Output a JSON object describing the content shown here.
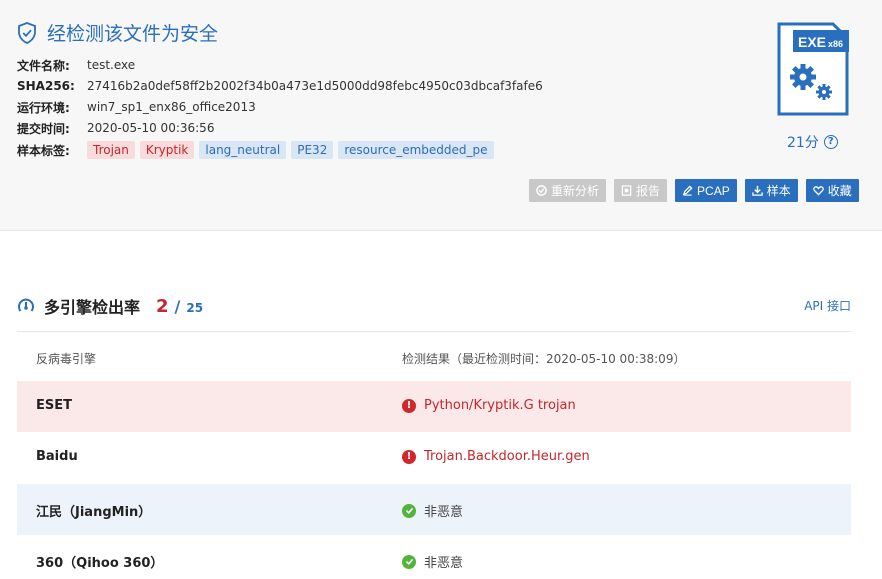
{
  "summary": {
    "verdict": "经检测该文件为安全",
    "fields": [
      {
        "key": "文件名称:",
        "value": "test.exe"
      },
      {
        "key": "SHA256:",
        "value": "27416b2a0def58ff2b2002f34b0a473e1d5000dd98febc4950c03dbcaf3fafe6"
      },
      {
        "key": "运行环境:",
        "value": "win7_sp1_enx86_office2013"
      },
      {
        "key": "提交时间:",
        "value": "2020-05-10 00:36:56"
      }
    ],
    "tags_label": "样本标签:",
    "tags": [
      {
        "label": "Trojan",
        "color": "#c4262c"
      },
      {
        "label": "Kryptik",
        "color": "#c4262c"
      },
      {
        "label": "lang_neutral",
        "color": "#2e6db6"
      },
      {
        "label": "PE32",
        "color": "#2e6db6"
      },
      {
        "label": "resource_embedded_pe",
        "color": "#2e6db6"
      }
    ],
    "file_icon": {
      "type": "EXE",
      "arch": "x86",
      "icon": "gears-icon"
    },
    "score": "21分",
    "actions": [
      {
        "label": "重新分析",
        "icon": "reanalyze-icon",
        "enabled": false
      },
      {
        "label": "报告",
        "icon": "report-icon",
        "enabled": false
      },
      {
        "label": "PCAP",
        "icon": "pcap-icon",
        "enabled": true
      },
      {
        "label": "样本",
        "icon": "download-icon",
        "enabled": true
      },
      {
        "label": "收藏",
        "icon": "heart-icon",
        "enabled": true
      }
    ]
  },
  "detection": {
    "title": "多引擎检出率",
    "hits": "2",
    "slash": "/",
    "total": "25",
    "api_link": "API 接口",
    "col_engine": "反病毒引擎",
    "col_result": "检测结果（最近检测时间：2020-05-10 00:38:09）",
    "rows": [
      {
        "engine": "ESET",
        "result": "Python/Kryptik.G trojan",
        "malicious": true
      },
      {
        "engine": "Baidu",
        "result": "Trojan.Backdoor.Heur.gen",
        "malicious": true
      },
      {
        "engine": "江民（JiangMin）",
        "result": "非恶意",
        "malicious": false
      },
      {
        "engine": "360（Qihoo 360）",
        "result": "非恶意",
        "malicious": false
      }
    ]
  },
  "colors": {
    "accent": "#2a6fbd",
    "danger": "#c4262c",
    "safe": "#52b33d"
  }
}
